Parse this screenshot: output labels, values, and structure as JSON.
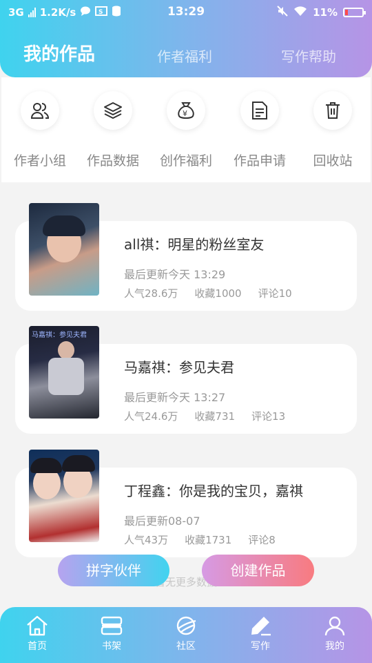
{
  "status_bar": {
    "network": "3G",
    "speed": "1.2K/s",
    "time": "13:29",
    "battery": "11%"
  },
  "header": {
    "tabs": [
      {
        "label": "我的作品",
        "active": true
      },
      {
        "label": "作者福利",
        "active": false
      },
      {
        "label": "写作帮助",
        "active": false
      }
    ]
  },
  "shortcuts": [
    {
      "label": "作者小组",
      "icon": "users-icon"
    },
    {
      "label": "作品数据",
      "icon": "layers-icon"
    },
    {
      "label": "创作福利",
      "icon": "money-bag-icon"
    },
    {
      "label": "作品申请",
      "icon": "document-icon"
    },
    {
      "label": "回收站",
      "icon": "trash-icon"
    }
  ],
  "works": [
    {
      "title": "all祺：明星的粉丝室友",
      "updated": "最后更新今天 13:29",
      "popularity": "人气28.6万",
      "favorites": "收藏1000",
      "comments": "评论10"
    },
    {
      "title": "马嘉祺：参见夫君",
      "cover_text": "马嘉祺：参见夫君",
      "updated": "最后更新今天 13:27",
      "popularity": "人气24.6万",
      "favorites": "收藏731",
      "comments": "评论13"
    },
    {
      "title": "丁程鑫：你是我的宝贝，嘉祺",
      "updated": "最后更新08-07",
      "popularity": "人气43万",
      "favorites": "收藏1731",
      "comments": "评论8"
    }
  ],
  "list_footer": "暂无更多数据",
  "actions": {
    "partner": "拼字伙伴",
    "create": "创建作品"
  },
  "bottom_nav": [
    {
      "label": "首页",
      "icon": "home-icon"
    },
    {
      "label": "书架",
      "icon": "bookshelf-icon"
    },
    {
      "label": "社区",
      "icon": "planet-icon"
    },
    {
      "label": "写作",
      "icon": "pen-icon",
      "active": true
    },
    {
      "label": "我的",
      "icon": "profile-icon"
    }
  ],
  "colors": {
    "gradient_start": "#3fd3ee",
    "gradient_end": "#b694e6",
    "create_start": "#d69ae4",
    "create_end": "#f87b80"
  }
}
